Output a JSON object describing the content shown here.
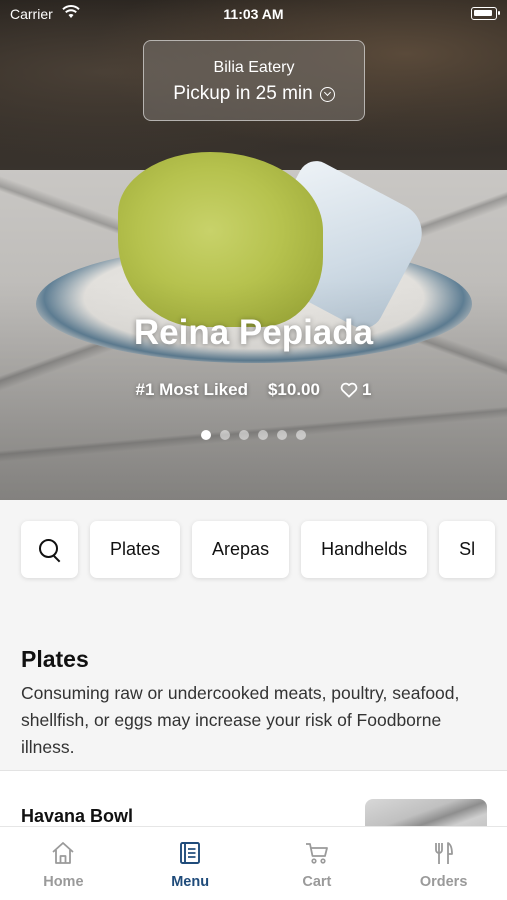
{
  "status_bar": {
    "carrier": "Carrier",
    "time": "11:03 AM"
  },
  "pickup": {
    "restaurant": "Bilia Eatery",
    "eta": "Pickup in 25 min"
  },
  "featured": {
    "title": "Reina Pepiada",
    "badge": "#1 Most Liked",
    "price": "$10.00",
    "likes": "1",
    "carousel_pages": 6,
    "carousel_active": 1
  },
  "categories": [
    "Plates",
    "Arepas",
    "Handhelds",
    "Sl"
  ],
  "section": {
    "title": "Plates",
    "description": "Consuming raw or undercooked meats, poultry, seafood, shellfish, or eggs may increase your risk of Foodborne illness."
  },
  "items": [
    {
      "name": "Havana Bowl"
    }
  ],
  "tabs": [
    {
      "label": "Home",
      "icon": "home-icon",
      "active": false
    },
    {
      "label": "Menu",
      "icon": "menu-book-icon",
      "active": true
    },
    {
      "label": "Cart",
      "icon": "cart-icon",
      "active": false
    },
    {
      "label": "Orders",
      "icon": "fork-knife-icon",
      "active": false
    }
  ],
  "colors": {
    "accent": "#1f4b7a",
    "inactive": "#9a9a9a"
  }
}
